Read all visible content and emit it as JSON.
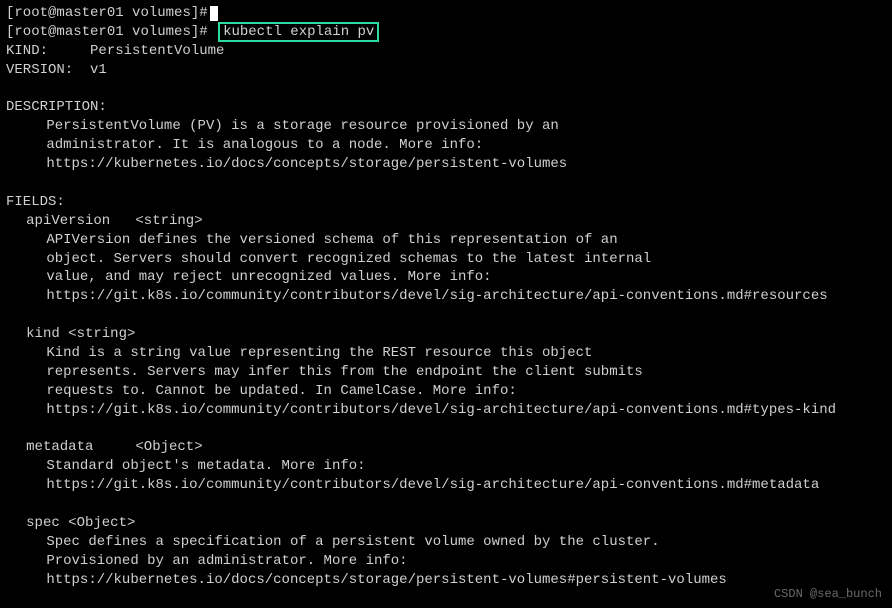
{
  "prompt": {
    "user": "root",
    "host": "master01",
    "path": "volumes",
    "symbol": "#"
  },
  "commands": {
    "line1": "",
    "line2": "kubectl explain pv"
  },
  "output": {
    "kind_label": "KIND:     ",
    "kind_value": "PersistentVolume",
    "version_label": "VERSION:  ",
    "version_value": "v1",
    "description_heading": "DESCRIPTION:",
    "description_lines": [
      "PersistentVolume (PV) is a storage resource provisioned by an",
      "administrator. It is analogous to a node. More info:",
      "https://kubernetes.io/docs/concepts/storage/persistent-volumes"
    ],
    "fields_heading": "FIELDS:",
    "fields": [
      {
        "name": "apiVersion",
        "type": "<string>",
        "lines": [
          "APIVersion defines the versioned schema of this representation of an",
          "object. Servers should convert recognized schemas to the latest internal",
          "value, and may reject unrecognized values. More info:",
          "https://git.k8s.io/community/contributors/devel/sig-architecture/api-conventions.md#resources"
        ]
      },
      {
        "name": "kind",
        "type": "<string>",
        "lines": [
          "Kind is a string value representing the REST resource this object",
          "represents. Servers may infer this from the endpoint the client submits",
          "requests to. Cannot be updated. In CamelCase. More info:",
          "https://git.k8s.io/community/contributors/devel/sig-architecture/api-conventions.md#types-kind"
        ]
      },
      {
        "name": "metadata",
        "type": "<Object>",
        "lines": [
          "Standard object's metadata. More info:",
          "https://git.k8s.io/community/contributors/devel/sig-architecture/api-conventions.md#metadata"
        ]
      },
      {
        "name": "spec",
        "type": "<Object>",
        "lines": [
          "Spec defines a specification of a persistent volume owned by the cluster.",
          "Provisioned by an administrator. More info:",
          "https://kubernetes.io/docs/concepts/storage/persistent-volumes#persistent-volumes"
        ]
      }
    ]
  },
  "watermark": "CSDN @sea_bunch"
}
